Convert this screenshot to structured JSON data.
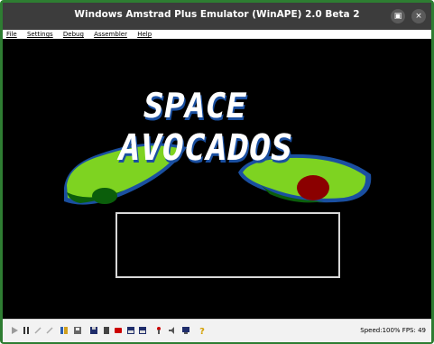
{
  "window": {
    "title": "Windows Amstrad Plus Emulator (WinAPE) 2.0 Beta 2",
    "maximize_glyph": "▣",
    "close_glyph": "×"
  },
  "menu": [
    "File",
    "Settings",
    "Debug",
    "Assembler",
    "Help"
  ],
  "game": {
    "title_line1": "SPACE",
    "title_line2": "AVOCADOS"
  },
  "toolbar": {
    "icons": [
      "play-icon",
      "pause-icon",
      "step-icon",
      "step-over-icon",
      "tape-icon",
      "disk-icon",
      "save-icon",
      "floppy-icon",
      "record-icon",
      "disk-drive-a-icon",
      "disk-drive-b-icon",
      "joystick-icon",
      "speaker-icon",
      "monitor-icon",
      "help-icon"
    ],
    "speed_text": "Speed:100%  FPS: 49"
  },
  "colors": {
    "frame": "#2e7d32",
    "titlebar": "#3c3c3c",
    "avocado_green": "#7ed321",
    "avocado_dark": "#0b5e0b",
    "pit": "#8b0000"
  }
}
